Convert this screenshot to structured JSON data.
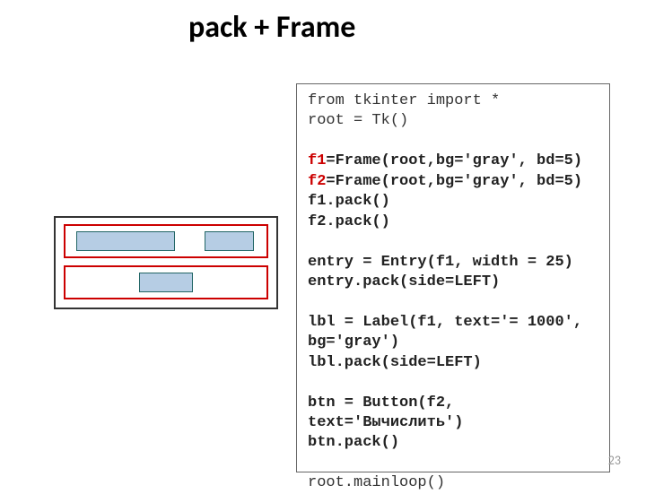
{
  "title": "pack + Frame",
  "page_number": "23",
  "code": {
    "l1": "from tkinter import *",
    "l2": "root = Tk()",
    "l3": "",
    "l4a": "f1",
    "l4b": "=Frame(root,bg='gray', bd=5)",
    "l5a": "f2",
    "l5b": "=Frame(root,bg='gray', bd=5)",
    "l6": "f1.pack()",
    "l7": "f2.pack()",
    "l8": "",
    "l9": "entry = Entry(f1, width = 25)",
    "l10": "entry.pack(side=LEFT)",
    "l11": "",
    "l12": "lbl = Label(f1, text='= 1000', bg='gray')",
    "l13": "lbl.pack(side=LEFT)",
    "l14": "",
    "l15": "btn = Button(f2, text='Вычислить')",
    "l16": "btn.pack()",
    "l17": "",
    "l18": "root.mainloop()"
  }
}
